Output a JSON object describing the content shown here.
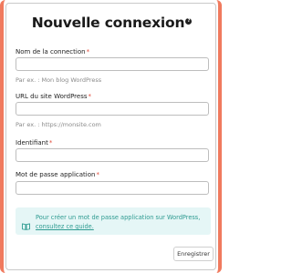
{
  "dialog": {
    "title": "Nouvelle connexion",
    "help_icon": "question-circle-icon",
    "help_glyph": "?"
  },
  "fields": {
    "connection_name": {
      "label": "Nom de la connection",
      "required_mark": "*",
      "value": "",
      "hint": "Par ex. : Mon blog WordPress"
    },
    "site_url": {
      "label": "URL du site WordPress",
      "required_mark": "*",
      "value": "",
      "hint": "Par ex. : https://monsite.com"
    },
    "identifier": {
      "label": "Identifiant",
      "required_mark": "*",
      "value": ""
    },
    "app_password": {
      "label": "Mot de passe application",
      "required_mark": "*",
      "value": ""
    }
  },
  "info": {
    "icon": "book-open-icon",
    "text": "Pour créer un mot de passe application sur WordPress, ",
    "link_text": "consultez ce guide."
  },
  "footer": {
    "save_label": "Enregistrer"
  },
  "colors": {
    "accent_border": "#f07a5e",
    "required": "#e14b3b",
    "info_bg": "#e5f6f6",
    "info_text": "#2e9b91"
  }
}
